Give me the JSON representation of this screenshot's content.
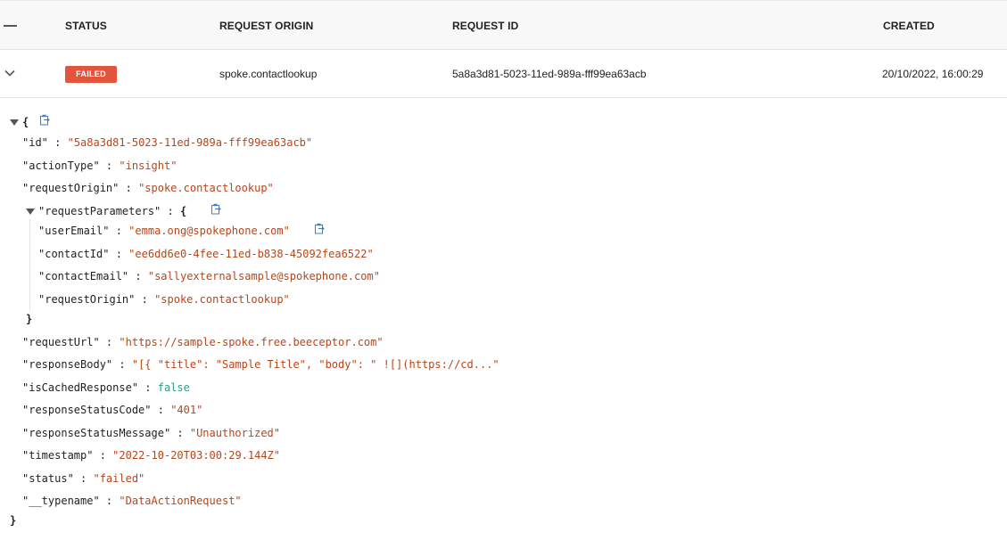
{
  "table": {
    "headers": {
      "status": "STATUS",
      "request_origin": "REQUEST ORIGIN",
      "request_id": "REQUEST ID",
      "created": "CREATED"
    },
    "row": {
      "status": "FAILED",
      "request_origin": "spoke.contactlookup",
      "request_id": "5a8a3d81-5023-11ed-989a-fff99ea63acb",
      "created": "20/10/2022, 16:00:29"
    }
  },
  "json": {
    "open_brace": "{",
    "close_brace": "}",
    "sep": " : ",
    "id_key": "\"id\"",
    "id_val": "\"5a8a3d81-5023-11ed-989a-fff99ea63acb\"",
    "actionType_key": "\"actionType\"",
    "actionType_val": "\"insight\"",
    "requestOrigin_key": "\"requestOrigin\"",
    "requestOrigin_val": "\"spoke.contactlookup\"",
    "requestParameters_key": "\"requestParameters\"",
    "userEmail_key": "\"userEmail\"",
    "userEmail_val": "\"emma.ong@spokephone.com\"",
    "contactId_key": "\"contactId\"",
    "contactId_val": "\"ee6dd6e0-4fee-11ed-b838-45092fea6522\"",
    "contactEmail_key": "\"contactEmail\"",
    "contactEmail_val": "\"sallyexternalsample@spokephone.com\"",
    "nestedRequestOrigin_key": "\"requestOrigin\"",
    "nestedRequestOrigin_val": "\"spoke.contactlookup\"",
    "requestUrl_key": "\"requestUrl\"",
    "requestUrl_val": "\"https://sample-spoke.free.beeceptor.com\"",
    "responseBody_key": "\"responseBody\"",
    "responseBody_val": "\"[{ \"title\": \"Sample Title\", \"body\": \" ![](https://cd...\"",
    "isCachedResponse_key": "\"isCachedResponse\"",
    "isCachedResponse_val": "false",
    "responseStatusCode_key": "\"responseStatusCode\"",
    "responseStatusCode_val": "\"401\"",
    "responseStatusMessage_key": "\"responseStatusMessage\"",
    "responseStatusMessage_val": "\"Unauthorized\"",
    "timestamp_key": "\"timestamp\"",
    "timestamp_val": "\"2022-10-20T03:00:29.144Z\"",
    "status_key": "\"status\"",
    "status_val": "\"failed\"",
    "typename_key": "\"__typename\"",
    "typename_val": "\"DataActionRequest\""
  },
  "icons": {
    "collapse_all": "minus-icon",
    "row_expand": "chevron-down-icon",
    "copy": "clipboard-copy-icon",
    "tree_toggle": "triangle-down-icon"
  },
  "colors": {
    "failed_badge": "#e2553d",
    "json_string": "#b5461a",
    "json_boolean": "#2a9d8f",
    "copy_icon": "#3f7fc1"
  }
}
